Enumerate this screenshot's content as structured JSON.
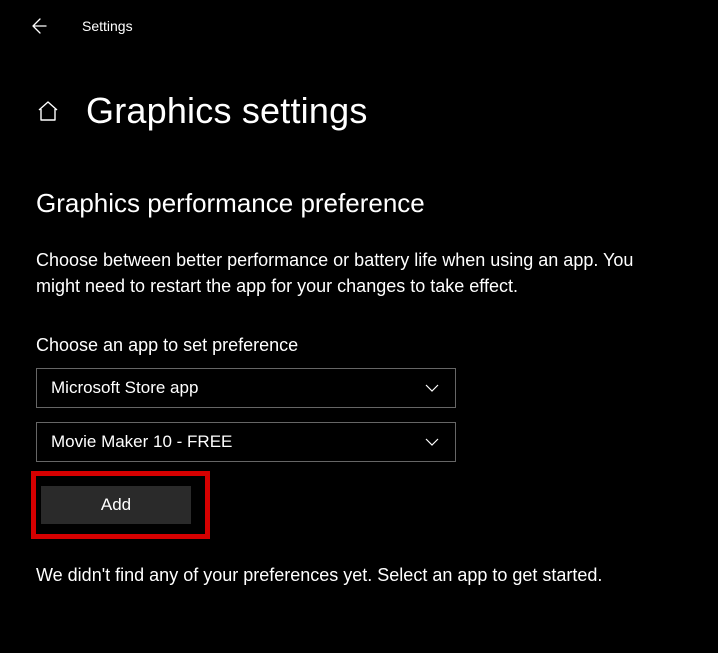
{
  "titlebar": {
    "label": "Settings"
  },
  "page": {
    "title": "Graphics settings"
  },
  "section": {
    "heading": "Graphics performance preference",
    "description": "Choose between better performance or battery life when using an app. You might need to restart the app for your changes to take effect.",
    "choose_label": "Choose an app to set preference",
    "app_type_selected": "Microsoft Store app",
    "app_selected": "Movie Maker 10 - FREE",
    "add_label": "Add",
    "footer_note": "We didn't find any of your preferences yet. Select an app to get started."
  }
}
